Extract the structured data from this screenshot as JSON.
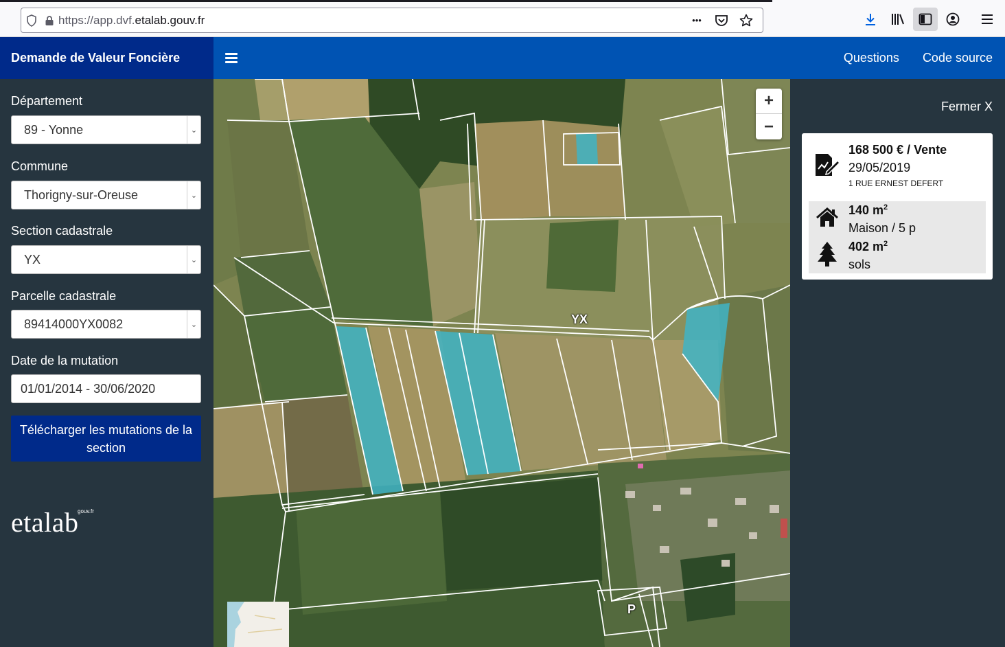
{
  "browser": {
    "url_prefix": "https://app.dvf.",
    "url_host": "etalab.gouv.fr",
    "url_suffix": "",
    "more_glyph": "•••"
  },
  "header": {
    "title": "Demande de Valeur Foncière",
    "nav": [
      "Questions",
      "Code source"
    ]
  },
  "sidebar": {
    "departement": {
      "label": "Département",
      "value": "89 - Yonne"
    },
    "commune": {
      "label": "Commune",
      "value": "Thorigny-sur-Oreuse"
    },
    "section": {
      "label": "Section cadastrale",
      "value": "YX"
    },
    "parcelle": {
      "label": "Parcelle cadastrale",
      "value": "89414000YX0082"
    },
    "date": {
      "label": "Date de la mutation",
      "value": "01/01/2014 - 30/06/2020"
    },
    "download_button": "Télécharger les mutations de la section",
    "logo": "etalab",
    "logo_sup": "gouv.fr"
  },
  "map": {
    "zoom_in": "+",
    "zoom_out": "−",
    "section_label": "YX",
    "parking_label": "P",
    "colors": {
      "selected_parcel": "#3fb4c6",
      "parcel_line": "#ffffff"
    }
  },
  "panel": {
    "close": "Fermer X",
    "mutation": {
      "price": "168 500 € / Vente",
      "date": "29/05/2019",
      "address": "1 RUE ERNEST DEFERT",
      "built_area": "140 m",
      "built_type": "Maison / 5 p",
      "land_area": "402 m",
      "land_type": "sols",
      "area_sup": "2"
    }
  }
}
